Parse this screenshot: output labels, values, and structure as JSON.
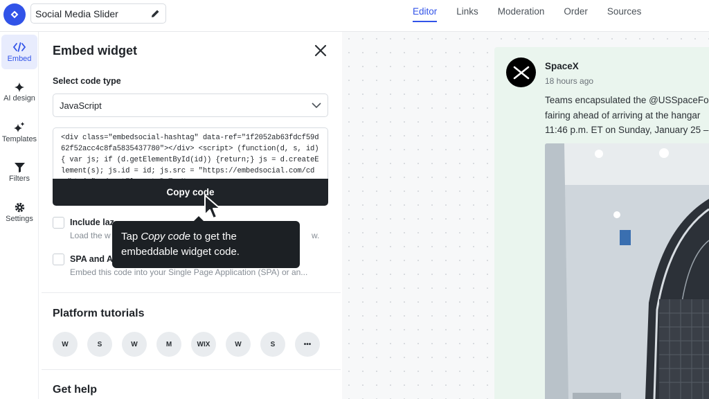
{
  "header": {
    "widget_name": "Social Media Slider",
    "tabs": [
      {
        "label": "Editor",
        "active": true
      },
      {
        "label": "Links",
        "active": false
      },
      {
        "label": "Moderation",
        "active": false
      },
      {
        "label": "Order",
        "active": false
      },
      {
        "label": "Sources",
        "active": false
      }
    ]
  },
  "leftnav": {
    "items": [
      {
        "label": "Embed",
        "icon": "code-icon",
        "active": true
      },
      {
        "label": "AI design",
        "icon": "sparkle-icon"
      },
      {
        "label": "Templates",
        "icon": "sparkles-icon"
      },
      {
        "label": "Filters",
        "icon": "filter-icon"
      },
      {
        "label": "Settings",
        "icon": "gear-icon"
      }
    ]
  },
  "panel": {
    "title": "Embed widget",
    "select_label": "Select code type",
    "select_value": "JavaScript",
    "code": "<div class=\"embedsocial-hashtag\" data-ref=\"1f2052ab63fdcf59d62f52acc4c8fa5835437780\"></div> <script> (function(d, s, id) { var js; if (d.getElementById(id)) {return;} js = d.createElement(s); js.id = id; js.src = \"https://embedsocial.com/cdn/ht.js\"; d.getElementsByTagNa",
    "copy_button": "Copy code",
    "option1_label": "Include laz",
    "option1_desc": "Load the w",
    "option1_desc_end": "w.",
    "option2_label": "SPA and A",
    "option2_desc": "Embed this code into your Single Page Application (SPA) or an...",
    "platform_tutorials_title": "Platform tutorials",
    "platforms": [
      {
        "name": "wordpress",
        "glyph": "W"
      },
      {
        "name": "shopify",
        "glyph": "S"
      },
      {
        "name": "webflow-w",
        "glyph": "W"
      },
      {
        "name": "magento",
        "glyph": "M"
      },
      {
        "name": "wix",
        "glyph": "WIX"
      },
      {
        "name": "webflow",
        "glyph": "W"
      },
      {
        "name": "squarespace",
        "glyph": "S"
      },
      {
        "name": "more",
        "glyph": "•••"
      }
    ],
    "get_help_title": "Get help"
  },
  "tooltip": {
    "prefix": "Tap ",
    "emphasis": "Copy code",
    "suffix": " to get the embeddable widget code."
  },
  "post": {
    "author": "SpaceX",
    "time": "18 hours ago",
    "line1": "Teams encapsulated the @USSpaceFo",
    "line2": "fairing ahead of arriving at the hangar",
    "line3": "11:46 p.m. ET on Sunday, January 25 –"
  },
  "colors": {
    "accent": "#3153e8",
    "dark": "#1f2328",
    "card_bg": "#eaf5ee"
  }
}
